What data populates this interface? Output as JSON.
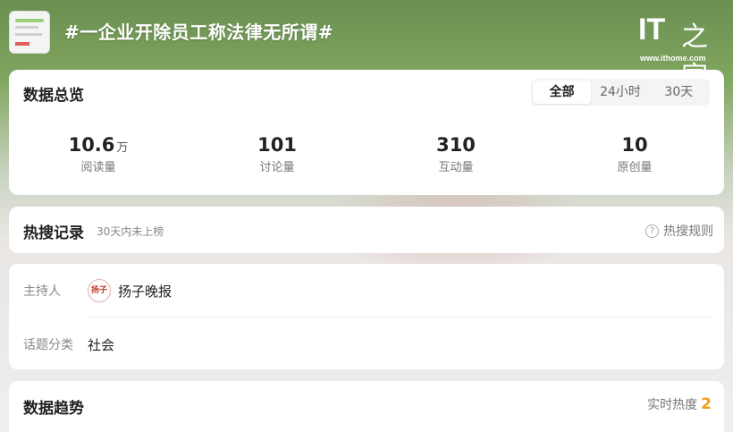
{
  "header": {
    "topic_title": "#一企业开除员工称法律无所谓#",
    "logo": {
      "brand_text": "IT之家",
      "url": "www.ithome.com"
    }
  },
  "overview": {
    "title": "数据总览",
    "tabs": [
      {
        "label": "全部",
        "active": true
      },
      {
        "label": "24小时",
        "active": false
      },
      {
        "label": "30天",
        "active": false
      }
    ],
    "stats": [
      {
        "value": "10.6",
        "unit": "万",
        "label": "阅读量"
      },
      {
        "value": "101",
        "unit": "",
        "label": "讨论量"
      },
      {
        "value": "310",
        "unit": "",
        "label": "互动量"
      },
      {
        "value": "10",
        "unit": "",
        "label": "原创量"
      }
    ]
  },
  "hot_search": {
    "title": "热搜记录",
    "subtitle": "30天内未上榜",
    "rules_label": "热搜规则"
  },
  "info": {
    "host_label": "主持人",
    "host_name": "扬子晚报",
    "category_label": "话题分类",
    "category_value": "社会"
  },
  "trend": {
    "title": "数据趋势",
    "realtime_label": "实时热度",
    "realtime_value": "2"
  },
  "colors": {
    "header_green": "#6a8f52",
    "accent_orange": "#f39c12"
  }
}
